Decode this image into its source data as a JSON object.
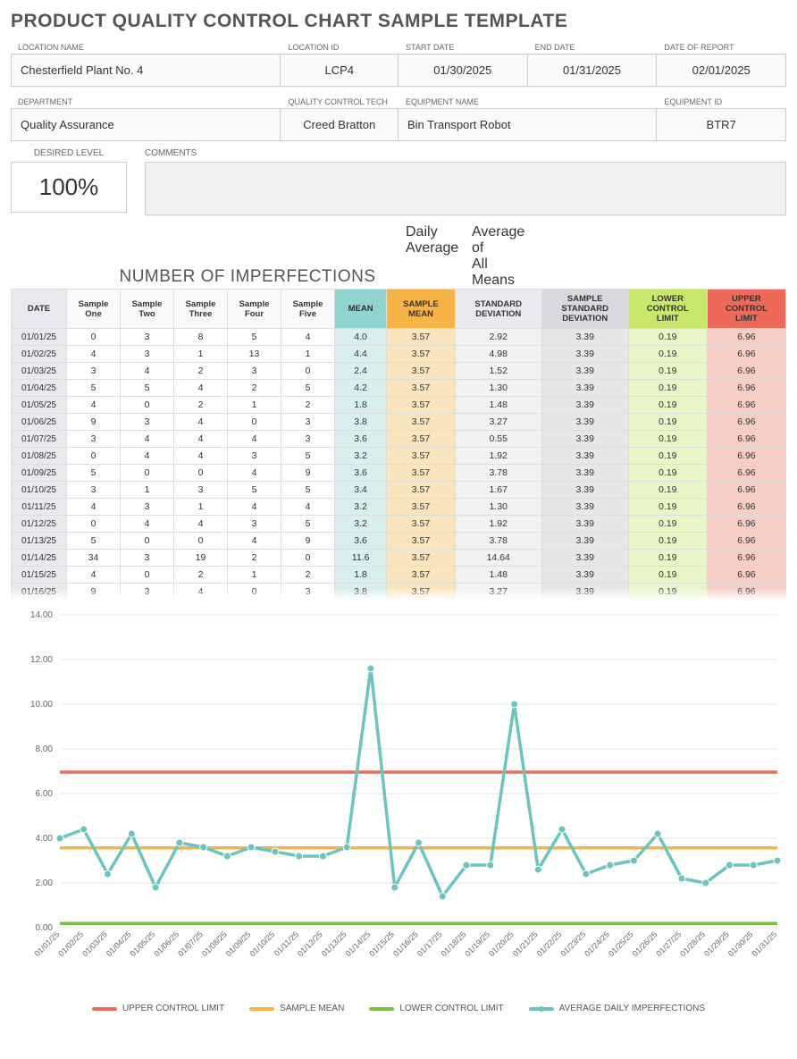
{
  "title": "PRODUCT QUALITY CONTROL CHART SAMPLE TEMPLATE",
  "meta1": {
    "labels": {
      "location_name": "LOCATION NAME",
      "location_id": "LOCATION ID",
      "start_date": "START DATE",
      "end_date": "END DATE",
      "report_date": "DATE OF REPORT"
    },
    "location_name": "Chesterfield Plant No. 4",
    "location_id": "LCP4",
    "start_date": "01/30/2025",
    "end_date": "01/31/2025",
    "report_date": "02/01/2025"
  },
  "meta2": {
    "labels": {
      "department": "DEPARTMENT",
      "tech": "QUALITY CONTROL TECH",
      "equipment": "EQUIPMENT NAME",
      "equipment_id": "EQUIPMENT ID"
    },
    "department": "Quality Assurance",
    "tech": "Creed Bratton",
    "equipment": "Bin Transport Robot",
    "equipment_id": "BTR7"
  },
  "desired": {
    "label": "DESIRED LEVEL",
    "value": "100%"
  },
  "comments": {
    "label": "COMMENTS",
    "value": ""
  },
  "section": {
    "title": "NUMBER OF IMPERFECTIONS",
    "daily_avg": "Daily\nAverage",
    "avg_means": "Average of\nAll Means"
  },
  "headers": {
    "date": "DATE",
    "s1": "Sample\nOne",
    "s2": "Sample\nTwo",
    "s3": "Sample\nThree",
    "s4": "Sample\nFour",
    "s5": "Sample\nFive",
    "mean": "MEAN",
    "smean": "SAMPLE\nMEAN",
    "std": "STANDARD\nDEVIATION",
    "sstd": "SAMPLE\nSTANDARD\nDEVIATION",
    "lcl": "LOWER\nCONTROL\nLIMIT",
    "ucl": "UPPER\nCONTROL\nLIMIT"
  },
  "constants": {
    "smean": "3.57",
    "sstd": "3.39",
    "lcl": "0.19",
    "ucl": "6.96"
  },
  "rows": [
    {
      "date": "01/01/25",
      "s": [
        0,
        3,
        8,
        5,
        4
      ],
      "mean": "4.0",
      "std": "2.92"
    },
    {
      "date": "01/02/25",
      "s": [
        4,
        3,
        1,
        13,
        1
      ],
      "mean": "4.4",
      "std": "4.98"
    },
    {
      "date": "01/03/25",
      "s": [
        3,
        4,
        2,
        3,
        0
      ],
      "mean": "2.4",
      "std": "1.52"
    },
    {
      "date": "01/04/25",
      "s": [
        5,
        5,
        4,
        2,
        5
      ],
      "mean": "4.2",
      "std": "1.30"
    },
    {
      "date": "01/05/25",
      "s": [
        4,
        0,
        2,
        1,
        2
      ],
      "mean": "1.8",
      "std": "1.48"
    },
    {
      "date": "01/06/25",
      "s": [
        9,
        3,
        4,
        0,
        3
      ],
      "mean": "3.8",
      "std": "3.27"
    },
    {
      "date": "01/07/25",
      "s": [
        3,
        4,
        4,
        4,
        3
      ],
      "mean": "3.6",
      "std": "0.55"
    },
    {
      "date": "01/08/25",
      "s": [
        0,
        4,
        4,
        3,
        5
      ],
      "mean": "3.2",
      "std": "1.92"
    },
    {
      "date": "01/09/25",
      "s": [
        5,
        0,
        0,
        4,
        9
      ],
      "mean": "3.6",
      "std": "3.78"
    },
    {
      "date": "01/10/25",
      "s": [
        3,
        1,
        3,
        5,
        5
      ],
      "mean": "3.4",
      "std": "1.67"
    },
    {
      "date": "01/11/25",
      "s": [
        4,
        3,
        1,
        4,
        4
      ],
      "mean": "3.2",
      "std": "1.30"
    },
    {
      "date": "01/12/25",
      "s": [
        0,
        4,
        4,
        3,
        5
      ],
      "mean": "3.2",
      "std": "1.92"
    },
    {
      "date": "01/13/25",
      "s": [
        5,
        0,
        0,
        4,
        9
      ],
      "mean": "3.6",
      "std": "3.78"
    },
    {
      "date": "01/14/25",
      "s": [
        34,
        3,
        19,
        2,
        0
      ],
      "mean": "11.6",
      "std": "14.64"
    },
    {
      "date": "01/15/25",
      "s": [
        4,
        0,
        2,
        1,
        2
      ],
      "mean": "1.8",
      "std": "1.48"
    },
    {
      "date": "01/16/25",
      "s": [
        9,
        3,
        4,
        0,
        3
      ],
      "mean": "3.8",
      "std": "3.27"
    }
  ],
  "chart_legend": {
    "ucl": "UPPER CONTROL LIMIT",
    "smean": "SAMPLE MEAN",
    "lcl": "LOWER CONTROL LIMIT",
    "avg": "AVERAGE DAILY IMPERFECTIONS"
  },
  "chart_data": {
    "type": "line",
    "title": "",
    "xlabel": "",
    "ylabel": "",
    "ylim": [
      0,
      14
    ],
    "yticks": [
      0,
      2,
      4,
      6,
      8,
      10,
      12,
      14
    ],
    "categories": [
      "01/01/25",
      "01/02/25",
      "01/03/25",
      "01/04/25",
      "01/05/25",
      "01/06/25",
      "01/07/25",
      "01/08/25",
      "01/09/25",
      "01/10/25",
      "01/11/25",
      "01/12/25",
      "01/13/25",
      "01/14/25",
      "01/15/25",
      "01/16/25",
      "01/17/25",
      "01/18/25",
      "01/19/25",
      "01/20/25",
      "01/21/25",
      "01/22/25",
      "01/23/25",
      "01/24/25",
      "01/25/25",
      "01/26/25",
      "01/27/25",
      "01/28/25",
      "01/29/25",
      "01/30/25",
      "01/31/25"
    ],
    "series": [
      {
        "name": "UPPER CONTROL LIMIT",
        "color": "#ed6a5a",
        "values": [
          6.96,
          6.96,
          6.96,
          6.96,
          6.96,
          6.96,
          6.96,
          6.96,
          6.96,
          6.96,
          6.96,
          6.96,
          6.96,
          6.96,
          6.96,
          6.96,
          6.96,
          6.96,
          6.96,
          6.96,
          6.96,
          6.96,
          6.96,
          6.96,
          6.96,
          6.96,
          6.96,
          6.96,
          6.96,
          6.96,
          6.96
        ]
      },
      {
        "name": "SAMPLE MEAN",
        "color": "#f5b445",
        "values": [
          3.57,
          3.57,
          3.57,
          3.57,
          3.57,
          3.57,
          3.57,
          3.57,
          3.57,
          3.57,
          3.57,
          3.57,
          3.57,
          3.57,
          3.57,
          3.57,
          3.57,
          3.57,
          3.57,
          3.57,
          3.57,
          3.57,
          3.57,
          3.57,
          3.57,
          3.57,
          3.57,
          3.57,
          3.57,
          3.57,
          3.57
        ]
      },
      {
        "name": "LOWER CONTROL LIMIT",
        "color": "#7bc043",
        "values": [
          0.19,
          0.19,
          0.19,
          0.19,
          0.19,
          0.19,
          0.19,
          0.19,
          0.19,
          0.19,
          0.19,
          0.19,
          0.19,
          0.19,
          0.19,
          0.19,
          0.19,
          0.19,
          0.19,
          0.19,
          0.19,
          0.19,
          0.19,
          0.19,
          0.19,
          0.19,
          0.19,
          0.19,
          0.19,
          0.19,
          0.19
        ]
      },
      {
        "name": "AVERAGE DAILY IMPERFECTIONS",
        "color": "#6cc3bf",
        "markers": true,
        "values": [
          4.0,
          4.4,
          2.4,
          4.2,
          1.8,
          3.8,
          3.6,
          3.2,
          3.6,
          3.4,
          3.2,
          3.2,
          3.6,
          11.6,
          1.8,
          3.8,
          1.4,
          2.8,
          2.8,
          10.0,
          2.6,
          4.4,
          2.4,
          2.8,
          3.0,
          4.2,
          2.2,
          2.0,
          2.8,
          2.8,
          3.0
        ]
      }
    ]
  }
}
